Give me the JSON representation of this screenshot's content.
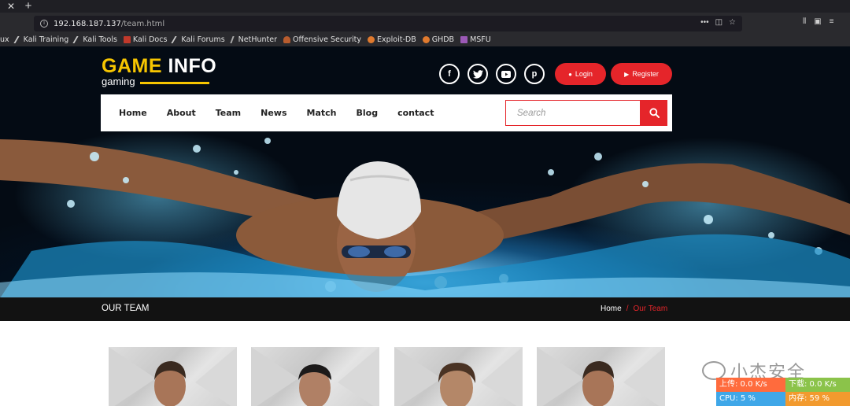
{
  "browser": {
    "url_host": "192.168.187.137",
    "url_path": "/team.html",
    "bookmarks": [
      "ux",
      "Kali Training",
      "Kali Tools",
      "Kali Docs",
      "Kali Forums",
      "NetHunter",
      "Offensive Security",
      "Exploit-DB",
      "GHDB",
      "MSFU"
    ]
  },
  "site": {
    "brand_word1": "GAME",
    "brand_word2": "INFO",
    "brand_sub": "gaming",
    "social_icons": [
      "facebook-icon",
      "twitter-icon",
      "youtube-icon",
      "pinterest-icon"
    ],
    "login_label": "Login",
    "register_label": "Register",
    "menu": [
      "Home",
      "About",
      "Team",
      "News",
      "Match",
      "Blog",
      "contact"
    ],
    "search_placeholder": "Search",
    "page_title": "OUR TEAM",
    "breadcrumb_home": "Home",
    "breadcrumb_sep": "/",
    "breadcrumb_current": "Our Team",
    "accent_color": "#e5252a",
    "brand_color": "#f7c600"
  },
  "overlay": {
    "watermark_text": "小杰安全",
    "upload": "上传: 0.0 K/s",
    "download": "下载: 0.0 K/s",
    "cpu": "CPU: 5 %",
    "memory": "内存: 59 %"
  }
}
